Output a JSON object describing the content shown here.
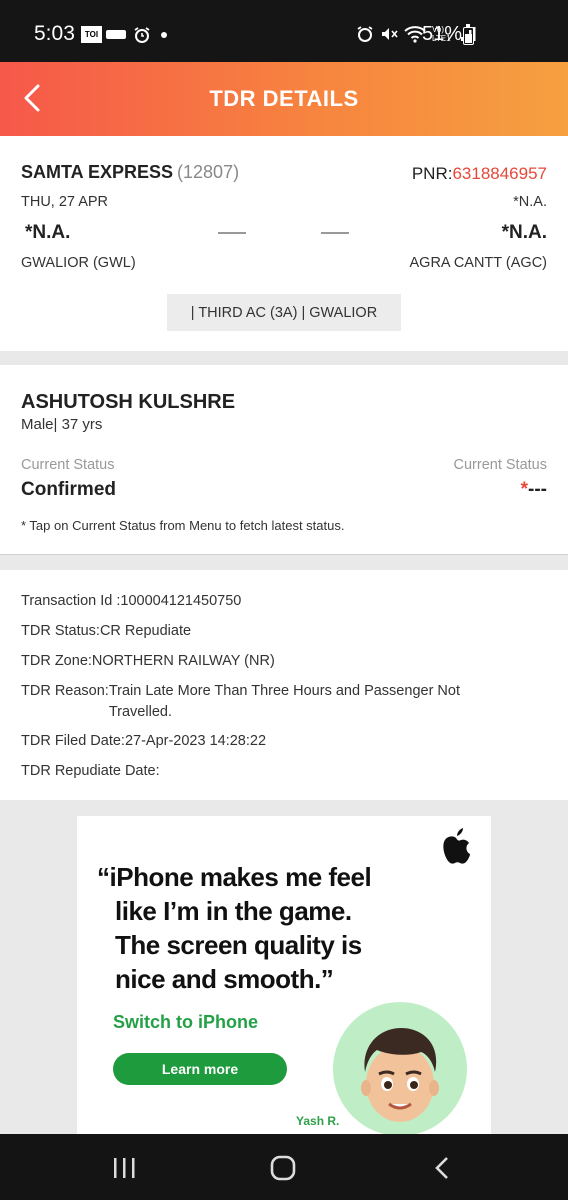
{
  "status_bar": {
    "time": "5:03",
    "toi_label": "TOI",
    "battery": "51%",
    "network": "Vo) LTE1"
  },
  "header": {
    "title": "TDR DETAILS",
    "back_icon": "chevron-left-icon"
  },
  "journey": {
    "train_name": "SAMTA EXPRESS",
    "train_number": "(12807)",
    "pnr_label": "PNR:",
    "pnr_value": "6318846957",
    "date_left": "THU, 27 APR",
    "date_right": "*N.A.",
    "time_left": "*N.A.",
    "time_right": "*N.A.",
    "from_station": "GWALIOR (GWL)",
    "to_station": "AGRA CANTT (AGC)",
    "class_info": "| THIRD AC (3A) | GWALIOR"
  },
  "passenger": {
    "name": "ASHUTOSH KULSHRE",
    "meta": "Male| 37 yrs",
    "status_label_left": "Current Status",
    "status_label_right": "Current Status",
    "status_value_left": "Confirmed",
    "status_value_right_star": "*",
    "status_value_right": "---",
    "note": "* Tap on Current Status from Menu to fetch latest status."
  },
  "tdr": {
    "transaction_id": "Transaction Id :100004121450750",
    "status": "TDR Status:CR Repudiate",
    "zone": "TDR Zone:NORTHERN RAILWAY (NR)",
    "reason_label": "TDR Reason:",
    "reason_value": "Train Late More Than Three Hours and Passenger Not Travelled.",
    "filed_date": "TDR Filed Date:27-Apr-2023 14:28:22",
    "repudiate_date": "TDR Repudiate Date:"
  },
  "ad": {
    "quote_line1": "“iPhone makes me feel",
    "quote_line2": "like I’m in the game.",
    "quote_line3": "The screen quality is",
    "quote_line4": "nice and smooth.”",
    "switch_text": "Switch to iPhone",
    "button_label": "Learn more",
    "attribution": "Yash R.",
    "brand_icon": "apple-logo-icon",
    "accent_color": "#1e9b3c"
  },
  "nav": {
    "recents_icon": "recents-icon",
    "home_icon": "home-icon",
    "back_icon": "back-icon"
  },
  "colors": {
    "header_start": "#f6584a",
    "header_end": "#f6a040",
    "pnr_accent": "#e5493a"
  }
}
